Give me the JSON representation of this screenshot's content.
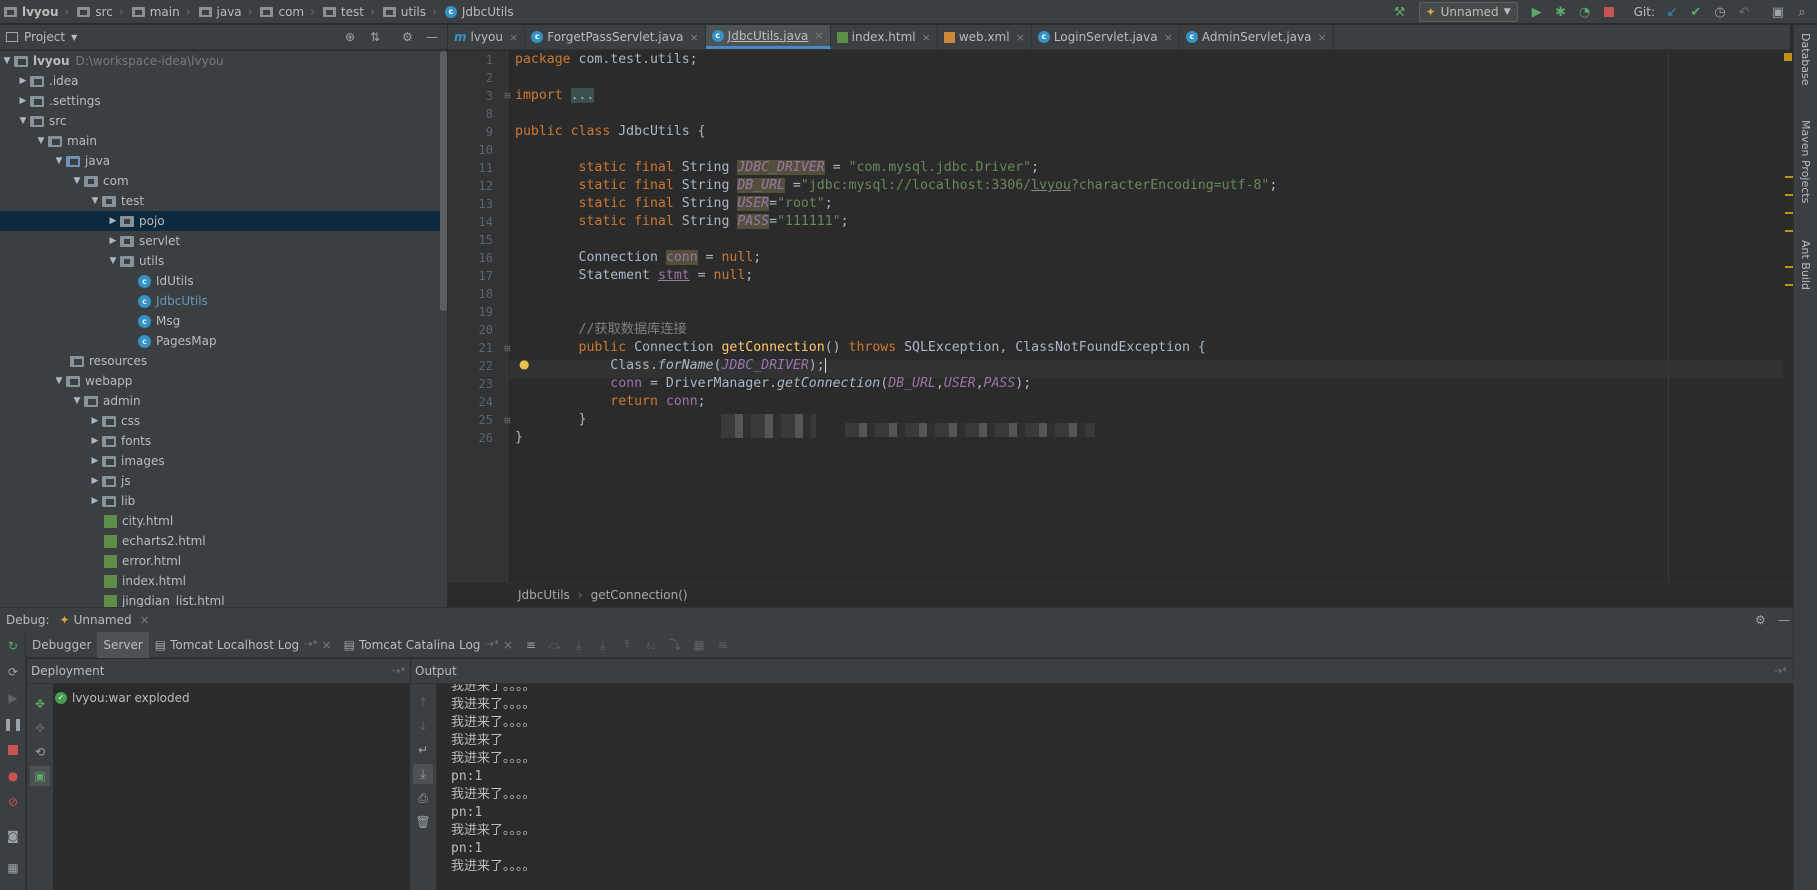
{
  "breadcrumb": [
    "lvyou",
    "src",
    "main",
    "java",
    "com",
    "test",
    "utils",
    "JdbcUtils"
  ],
  "toolbar": {
    "run_config": "Unnamed",
    "git_label": "Git:"
  },
  "project_panel": {
    "title": "Project",
    "root": {
      "name": "lvyou",
      "path": "D:\\workspace-idea\\lvyou"
    },
    "rows": [
      ".idea",
      ".settings",
      "src",
      "main",
      "java",
      "com",
      "test",
      "pojo",
      "servlet",
      "utils",
      "IdUtils",
      "JdbcUtils",
      "Msg",
      "PagesMap",
      "resources",
      "webapp",
      "admin",
      "css",
      "fonts",
      "images",
      "js",
      "lib",
      "city.html",
      "echarts2.html",
      "error.html",
      "index.html",
      "jingdian_list.html"
    ]
  },
  "editor_tabs": [
    "lvyou",
    "ForgetPassServlet.java",
    "JdbcUtils.java",
    "index.html",
    "web.xml",
    "LoginServlet.java",
    "AdminServlet.java"
  ],
  "line_numbers": [
    "1",
    "2",
    "3",
    "8",
    "9",
    "10",
    "11",
    "12",
    "13",
    "14",
    "15",
    "16",
    "17",
    "18",
    "19",
    "20",
    "21",
    "22",
    "23",
    "24",
    "25",
    "26"
  ],
  "code": {
    "pkg_kw": "package",
    "pkg_name": " com.test.utils;",
    "import_kw": "import",
    "import_fold": "...",
    "class_kw": "public class",
    "class_name": " JdbcUtils {",
    "sfs": "static final",
    "string": " String ",
    "jdbc_driver": "JDBC_DRIVER",
    "jdbc_driver_val": "\"com.mysql.jdbc.Driver\"",
    "db_url": "DB_URL",
    "db_url_val_a": "\"jdbc:mysql://localhost:3306/",
    "db_url_val_b": "lvyou",
    "db_url_val_c": "?characterEncoding=utf-8\"",
    "user": "USER",
    "user_val": "\"root\"",
    "pass": "PASS",
    "pass_val": "\"111111\"",
    "connection": "Connection ",
    "conn": "conn",
    "null": "null",
    "statement": "Statement ",
    "stmt": "stmt",
    "comment": "//获取数据库连接",
    "public": "public",
    "getconn": "getConnection",
    "throws": "throws",
    "exceptions": " SQLException, ClassNotFoundException {",
    "class_forname_a": "Class.",
    "forname": "forName",
    "dm": "DriverManager.",
    "dm_get": "getConnection",
    "return_kw": "return"
  },
  "editor_breadcrumb": [
    "JdbcUtils",
    "getConnection()"
  ],
  "debug": {
    "label": "Debug:",
    "config": "Unnamed",
    "tabs": [
      "Debugger",
      "Server",
      "Tomcat Localhost Log",
      "Tomcat Catalina Log"
    ],
    "deployment_title": "Deployment",
    "deployment_item": "lvyou:war exploded",
    "output_title": "Output",
    "output_lines": [
      "我进来了。。。。",
      "我进来了。。。。",
      "我进来了。。。。",
      "我进来了",
      "我进来了。。。。",
      "pn:1",
      "我进来了。。。。",
      "pn:1",
      "我进来了。。。。",
      "pn:1",
      "我进来了。。。。"
    ]
  },
  "right_tools": [
    "Database",
    "Maven Projects",
    "Ant Build"
  ],
  "colors": {
    "accent": "#4a88c7",
    "keyword": "#cc7832",
    "string": "#6a8759",
    "constant": "#9876aa"
  }
}
